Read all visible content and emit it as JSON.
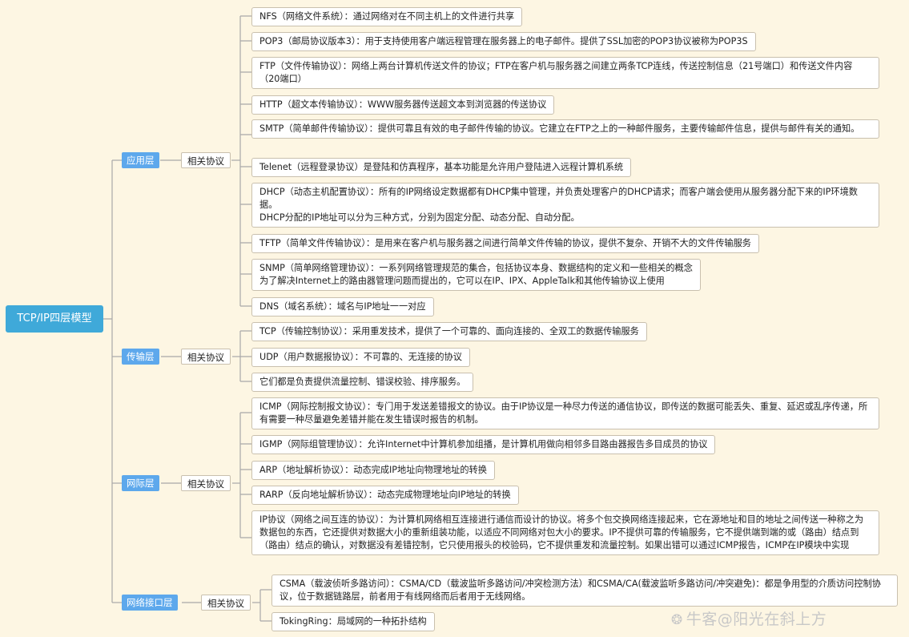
{
  "root": "TCP/IP四层模型",
  "related_label": "相关协议",
  "layers": {
    "app": {
      "name": "应用层",
      "items": [
        "NFS（网络文件系统）：通过网络对在不同主机上的文件进行共享",
        "POP3（邮局协议版本3）：用于支持使用客户端远程管理在服务器上的电子邮件。提供了SSL加密的POP3协议被称为POP3S",
        "FTP（文件传输协议）：网络上两台计算机传送文件的协议；FTP在客户机与服务器之间建立两条TCP连线，传送控制信息（21号端口）和传送文件内容（20端口）",
        "HTTP（超文本传输协议）：WWW服务器传送超文本到浏览器的传送协议",
        "SMTP（简单邮件传输协议）：提供可靠且有效的电子邮件传输的协议。它建立在FTP之上的一种邮件服务，主要传输邮件信息，提供与邮件有关的通知。",
        "Telenet（远程登录协议）是登陆和仿真程序，基本功能是允许用户登陆进入远程计算机系统",
        "DHCP（动态主机配置协议）：所有的IP网络设定数据都有DHCP集中管理，并负责处理客户的DHCP请求；而客户端会使用从服务器分配下来的IP环境数据。\nDHCP分配的IP地址可以分为三种方式，分别为固定分配、动态分配、自动分配。",
        "TFTP（简单文件传输协议）：是用来在客户机与服务器之间进行简单文件传输的协议，提供不复杂、开销不大的文件传输服务",
        "SNMP（简单网络管理协议）：一系列网络管理规范的集合，包括协议本身、数据结构的定义和一些相关的概念\n为了解决Internet上的路由器管理问题而提出的，它可以在IP、IPX、AppleTalk和其他传输协议上使用",
        "DNS（域名系统）：域名与IP地址一一对应"
      ]
    },
    "transport": {
      "name": "传输层",
      "items": [
        "TCP（传输控制协议）：采用重发技术，提供了一个可靠的、面向连接的、全双工的数据传输服务",
        "UDP（用户数据报协议）：不可靠的、无连接的协议",
        "它们都是负责提供流量控制、错误校验、排序服务。"
      ]
    },
    "internet": {
      "name": "网际层",
      "items": [
        "ICMP（网际控制报文协议）：专门用于发送差错报文的协议。由于IP协议是一种尽力传送的通信协议，即传送的数据可能丢失、重复、延迟或乱序传递，所有需要一种尽量避免差错并能在发生错误时报告的机制。",
        "IGMP（网际组管理协议）：允许Internet中计算机参加组播，是计算机用做向相邻多目路由器报告多目成员的协议",
        "ARP（地址解析协议）：动态完成IP地址向物理地址的转换",
        "RARP（反向地址解析协议）：动态完成物理地址向IP地址的转换",
        "IP协议（网络之间互连的协议）：为计算机网络相互连接进行通信而设计的协议。将多个包交换网络连接起来，它在源地址和目的地址之间传送一种称之为数据包的东西，它还提供对数据大小的重新组装功能，以适应不同网络对包大小的要求。IP不提供可靠的传输服务，它不提供端到端的或（路由）结点到（路由）结点的确认，对数据没有差错控制，它只使用报头的校验码，它不提供重发和流量控制。如果出错可以通过ICMP报告，ICMP在IP模块中实现"
      ]
    },
    "link": {
      "name": "网络接口层",
      "items": [
        "CSMA（载波侦听多路访问）：CSMA/CD（载波监听多路访问/冲突检测方法）和CSMA/CA(载波监听多路访问/冲突避免)：都是争用型的介质访问控制协议，位于数据链路层，前者用于有线网络而后者用于无线网络。",
        "TokingRing：局域网的一种拓扑结构"
      ]
    }
  },
  "watermark": "牛客@阳光在斜上方",
  "watermark_icon": "niuke-logo-icon",
  "colors": {
    "background": "#FDF6E3",
    "root": "#3FA9D9",
    "layer": "#5DA8EC",
    "line": "#A8A8A8",
    "box_border": "#C9C0AE"
  }
}
